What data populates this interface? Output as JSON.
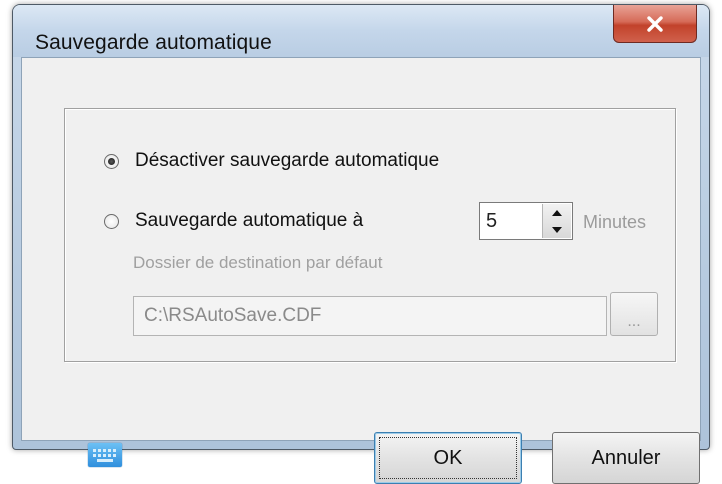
{
  "window": {
    "title": "Sauvegarde automatique"
  },
  "options": {
    "disable_label": "Désactiver sauvegarde automatique",
    "disable_selected": true,
    "autosave_label": "Sauvegarde automatique à",
    "autosave_selected": false,
    "interval_value": "5",
    "interval_unit": "Minutes",
    "folder_label": "Dossier de destination par défaut",
    "folder_path": "C:\\RSAutoSave.CDF",
    "browse_label": "..."
  },
  "buttons": {
    "ok_label": "OK",
    "cancel_label": "Annuler"
  },
  "icons": {
    "close": "close-icon",
    "keyboard": "keyboard-icon",
    "spin_up": "arrow-up-icon",
    "spin_down": "arrow-down-icon"
  },
  "colors": {
    "close_button": "#c9503a",
    "titlebar": "#c4d6ea",
    "disabled_text": "#9b9b9b",
    "keyboard_icon": "#3a9be3"
  }
}
